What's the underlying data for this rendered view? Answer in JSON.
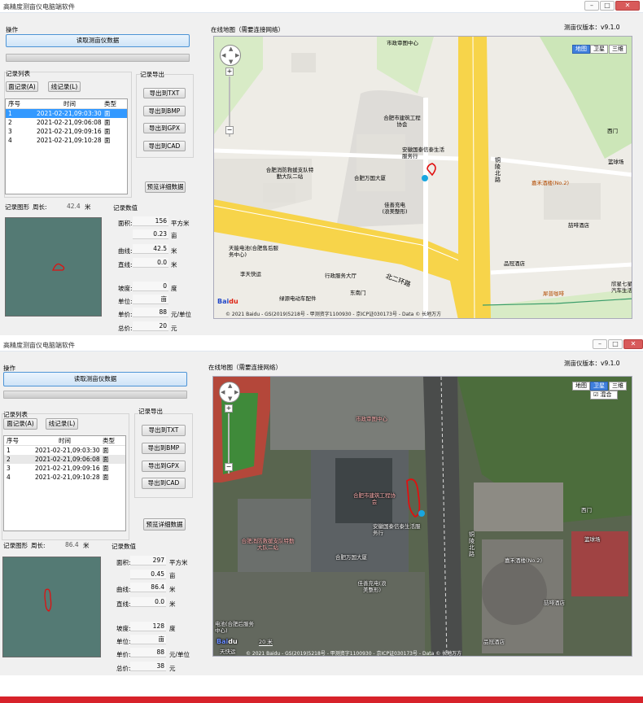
{
  "win1": {
    "title": "高精度测亩仪电脑端软件",
    "ops_label": "操作",
    "read_button": "读取测亩仪数据",
    "records_label": "记录列表",
    "area_button": "面记录(A)",
    "line_button": "线记录(L)",
    "export_label": "记录导出",
    "export_txt": "导出到TXT",
    "export_bmp": "导出到BMP",
    "export_gpx": "导出到GPX",
    "export_cad": "导出到CAD",
    "preview_button": "预览详细数据",
    "table_headers": [
      "序号",
      "时间",
      "类型"
    ],
    "rows": [
      {
        "no": "1",
        "time": "2021-02-21,09:03:30",
        "type": "面"
      },
      {
        "no": "2",
        "time": "2021-02-21,09:06:08",
        "type": "面"
      },
      {
        "no": "3",
        "time": "2021-02-21,09:09:16",
        "type": "面"
      },
      {
        "no": "4",
        "time": "2021-02-21,09:10:28",
        "type": "面"
      }
    ],
    "shape_label": "记录图形",
    "perimeter_label": "周长:",
    "perimeter_value": "42.4",
    "perimeter_unit": "米",
    "values_label": "记录数值",
    "area_label": "面积:",
    "area_sqm": "156",
    "area_sqm_unit": "平方米",
    "area_mu": "0.23",
    "area_mu_unit": "亩",
    "curve_label": "曲线:",
    "curve_value": "42.5",
    "curve_unit": "米",
    "straight_label": "直线:",
    "straight_value": "0.0",
    "straight_unit": "米",
    "slope_label": "坡度:",
    "slope_value": "0",
    "slope_unit": "度",
    "unit_label": "单位:",
    "unit_value": "亩",
    "price_label": "单价:",
    "price_value": "88",
    "price_unit": "元/单位",
    "total_label": "总价:",
    "total_value": "20",
    "total_unit": "元",
    "map_label": "在线地图（需要连接网络）",
    "version": "测亩仪版本：v9.1.0",
    "map_types": [
      "地图",
      "卫星",
      "三维"
    ],
    "map_selected": "地图",
    "footer": "© 2021 Baidu - GS(2019)5218号 - 甲测资字1100930 - 京ICP证030173号 - Data © 长地万方",
    "pois": [
      "市政审图中心",
      "合肥市建筑工程协会",
      "安徽国泰信泰生活服务行",
      "合肥万国大厦",
      "合肥消防救援支队特勤大队二站",
      "佳善充电(浪美整形)",
      "东南门",
      "天能电池(合肥售后服务中心)",
      "李天快运",
      "绿源电动车配件",
      "行政服务大厅",
      "北二环路",
      "嘉禾酒楼(No.2)",
      "喆啡酒店",
      "品冠酒店",
      "犀普咖啡",
      "篮球场",
      "欣星七星汽车生活",
      "西门",
      "铜陵北路"
    ]
  },
  "win2": {
    "title": "高精度测亩仪电脑端软件",
    "ops_label": "操作",
    "read_button": "读取测亩仪数据",
    "records_label": "记录列表",
    "area_button": "面记录(A)",
    "line_button": "线记录(L)",
    "export_label": "记录导出",
    "export_txt": "导出到TXT",
    "export_bmp": "导出到BMP",
    "export_gpx": "导出到GPX",
    "export_cad": "导出到CAD",
    "preview_button": "预览详细数据",
    "table_headers": [
      "序号",
      "时间",
      "类型"
    ],
    "rows": [
      {
        "no": "1",
        "time": "2021-02-21,09:03:30",
        "type": "面"
      },
      {
        "no": "2",
        "time": "2021-02-21,09:06:08",
        "type": "面"
      },
      {
        "no": "3",
        "time": "2021-02-21,09:09:16",
        "type": "面"
      },
      {
        "no": "4",
        "time": "2021-02-21,09:10:28",
        "type": "面"
      }
    ],
    "shape_label": "记录图形",
    "perimeter_label": "周长:",
    "perimeter_value": "86.4",
    "perimeter_unit": "米",
    "values_label": "记录数值",
    "area_label": "面积:",
    "area_sqm": "297",
    "area_sqm_unit": "平方米",
    "area_mu": "0.45",
    "area_mu_unit": "亩",
    "curve_label": "曲线:",
    "curve_value": "86.4",
    "curve_unit": "米",
    "straight_label": "直线:",
    "straight_value": "0.0",
    "straight_unit": "米",
    "slope_label": "坡度:",
    "slope_value": "128",
    "slope_unit": "度",
    "unit_label": "单位:",
    "unit_value": "亩",
    "price_label": "单价:",
    "price_value": "88",
    "price_unit": "元/单位",
    "total_label": "总价:",
    "total_value": "38",
    "total_unit": "元",
    "map_label": "在线地图（需要连接网络）",
    "version": "测亩仪版本：v9.1.0",
    "map_types": [
      "地图",
      "卫星",
      "三维"
    ],
    "map_selected": "卫星",
    "hybrid_label": "混合",
    "scale": "20 米",
    "footer": "© 2021 Baidu - GS(2019)5218号 - 甲测资字1100930 - 京ICP证030173号 - Data © 长地万方",
    "pois": [
      "合肥市建筑工程协会",
      "安徽国泰信泰生活服务行",
      "合肥万国大厦",
      "合肥消防救援支队特勤大队二站",
      "佳善充电(浪美整形)",
      "嘉禾酒楼(No.2)",
      "喆啡酒店",
      "品冠酒店",
      "篮球场",
      "西门",
      "铜陵北路",
      "电池(合肥后服务中心)",
      "天快运",
      "市政审图中心"
    ]
  },
  "colors": {
    "accent": "#3399ff",
    "trace": "#e01010",
    "canvas": "#547a74",
    "road_yellow": "#f7d44a",
    "banner": "#d7222a"
  }
}
